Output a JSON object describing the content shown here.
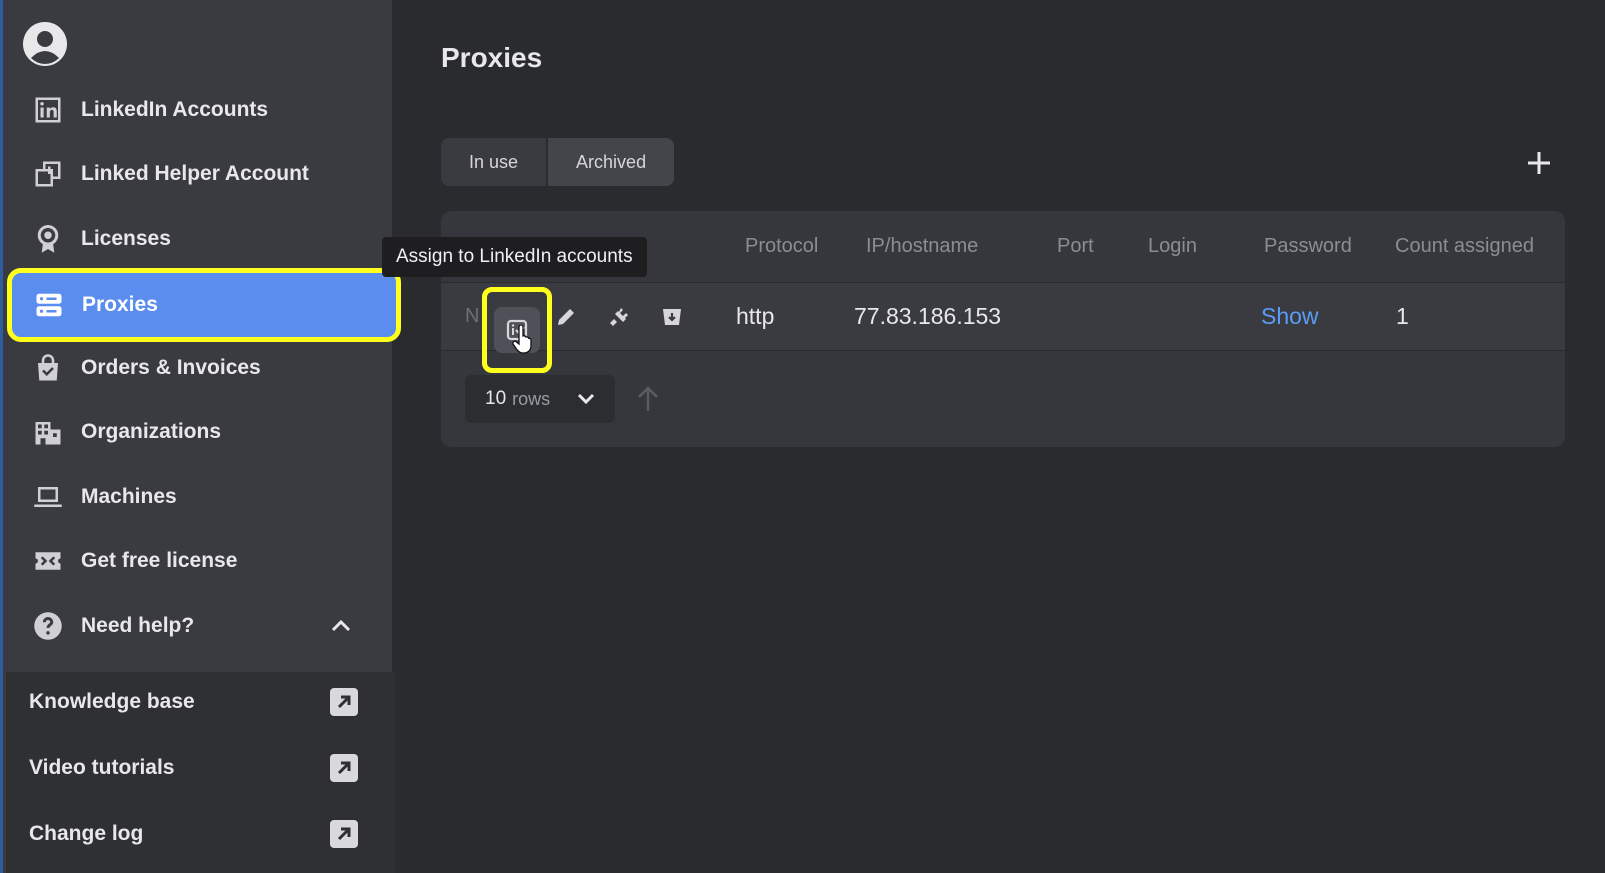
{
  "sidebar": {
    "items": [
      {
        "label": "LinkedIn Accounts",
        "icon": "linkedin-icon"
      },
      {
        "label": "Linked Helper Account",
        "icon": "copy-window-icon"
      },
      {
        "label": "Licenses",
        "icon": "award-ribbon-icon"
      },
      {
        "label": "Proxies",
        "icon": "server-icon",
        "active": true
      },
      {
        "label": "Orders & Invoices",
        "icon": "shopping-bag-icon"
      },
      {
        "label": "Organizations",
        "icon": "building-icon"
      },
      {
        "label": "Machines",
        "icon": "laptop-icon"
      },
      {
        "label": "Get free license",
        "icon": "ticket-icon"
      },
      {
        "label": "Need help?",
        "icon": "question-circle-icon"
      }
    ],
    "help_links": [
      {
        "label": "Knowledge base"
      },
      {
        "label": "Video tutorials"
      },
      {
        "label": "Change log"
      }
    ]
  },
  "main": {
    "title": "Proxies",
    "tabs": [
      {
        "label": "In use"
      },
      {
        "label": "Archived"
      }
    ],
    "table": {
      "columns": [
        "Protocol",
        "IP/hostname",
        "Port",
        "Login",
        "Password",
        "Count assigned"
      ],
      "row_prefix": "N",
      "rows": [
        {
          "protocol": "http",
          "ip": "77.83.186.153",
          "port": "",
          "login": "",
          "password": "Show",
          "count": "1"
        }
      ]
    },
    "pagination": {
      "rows_value": "10",
      "rows_unit": "rows"
    },
    "tooltip": "Assign to LinkedIn accounts"
  },
  "colors": {
    "accent": "#5b8def",
    "highlight": "#ffff1e",
    "link": "#5b9cf5"
  }
}
